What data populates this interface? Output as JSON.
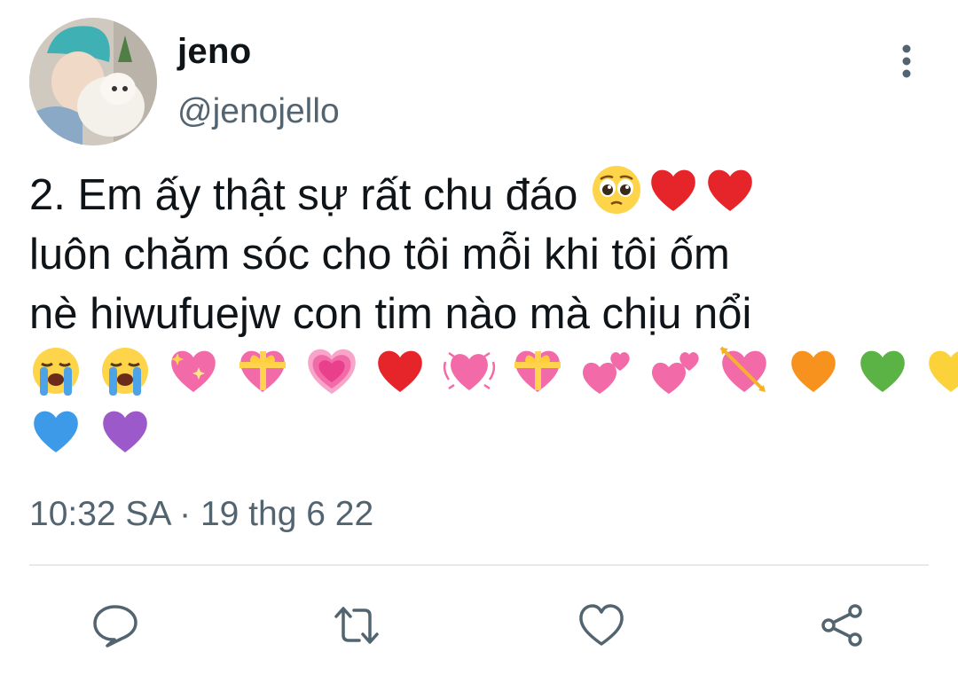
{
  "author": {
    "display_name": "jeno",
    "handle": "@jenojello"
  },
  "tweet": {
    "line1_text": "2. Em ấy thật sự rất chu đáo",
    "line1_emojis": [
      "pleading-face",
      "red-heart",
      "red-heart"
    ],
    "line2_text": "luôn chăm sóc cho tôi mỗi khi tôi ốm",
    "line3_text": "nè hiwufuejw con tim nào mà chịu nổi",
    "emoji_row_1": [
      "loudly-crying-face",
      "loudly-crying-face",
      "sparkling-heart",
      "heart-with-ribbon",
      "growing-heart",
      "red-heart",
      "beating-heart",
      "heart-with-ribbon",
      "two-hearts",
      "two-hearts",
      "heart-with-arrow",
      "orange-heart",
      "green-heart",
      "yellow-heart"
    ],
    "emoji_row_2": [
      "blue-heart",
      "purple-heart"
    ]
  },
  "timestamp": "10:32 SA · 19 thg 6 22",
  "actions": {
    "reply_icon": "reply-icon",
    "retweet_icon": "retweet-icon",
    "like_icon": "like-icon",
    "share_icon": "share-icon"
  },
  "colors": {
    "text_primary": "#0f1419",
    "text_secondary": "#536471",
    "icon": "#536471",
    "divider": "#e6e9eb"
  }
}
